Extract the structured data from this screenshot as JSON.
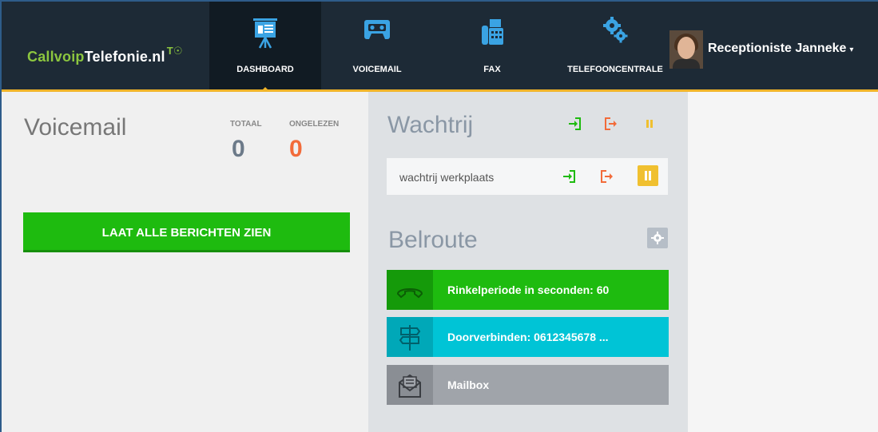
{
  "app": {
    "logo": {
      "part1": "Callvoip",
      "part2": "Telefonie.nl",
      "mark": "T☉"
    }
  },
  "nav": {
    "items": [
      {
        "label": "DASHBOARD",
        "icon": "presentation-board-icon",
        "active": true
      },
      {
        "label": "VOICEMAIL",
        "icon": "cassette-icon",
        "active": false
      },
      {
        "label": "FAX",
        "icon": "fax-icon",
        "active": false
      },
      {
        "label": "TELEFOONCENTRALE",
        "icon": "gears-icon",
        "active": false
      }
    ]
  },
  "user": {
    "name": "Receptioniste Janneke",
    "dropdown": "▾"
  },
  "voicemail": {
    "title": "Voicemail",
    "total_label": "TOTAAL",
    "total_value": "0",
    "unread_label": "ONGELEZEN",
    "unread_value": "0",
    "button_label": "LAAT ALLE BERICHTEN ZIEN"
  },
  "wachtrij": {
    "title": "Wachtrij",
    "queues": [
      {
        "name": "wachtrij werkplaats"
      }
    ]
  },
  "belroute": {
    "title": "Belroute",
    "steps": [
      {
        "label": "Rinkelperiode in seconden: 60",
        "icon": "phone-handset-icon",
        "color": "#1ebb0f",
        "icon_bg": "#159a0a"
      },
      {
        "label": "Doorverbinden: 0612345678 ...",
        "icon": "signpost-icon",
        "color": "#00c4d6",
        "icon_bg": "#00a8b8"
      },
      {
        "label": "Mailbox",
        "icon": "envelope-icon",
        "color": "#a0a4aa",
        "icon_bg": "#8a8e94"
      }
    ]
  },
  "colors": {
    "topbar": "#1d2a36",
    "accent": "#f0b429",
    "green": "#1ebb0f",
    "orange": "#f26b3a",
    "grey_value": "#6c7a89"
  }
}
